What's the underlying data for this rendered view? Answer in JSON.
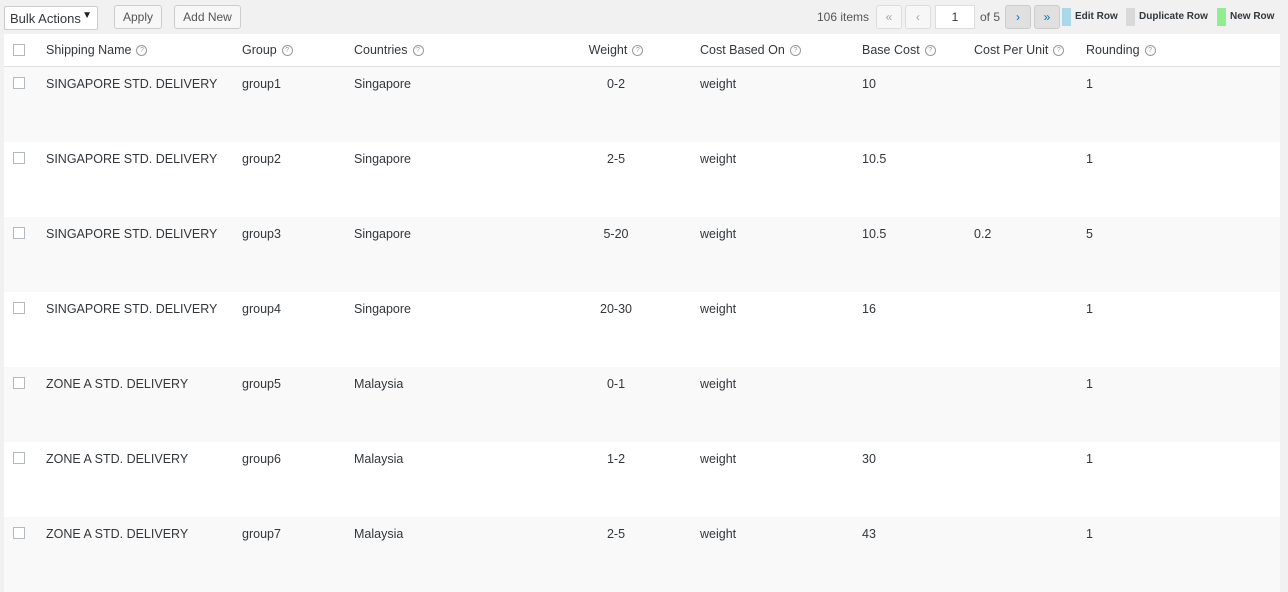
{
  "toolbar": {
    "bulk_actions_label": "Bulk Actions",
    "apply_label": "Apply",
    "add_new_label": "Add New"
  },
  "pagination": {
    "items_count": "106 items",
    "first": "«",
    "prev": "‹",
    "current_page": "1",
    "of_label": "of 5",
    "next": "›",
    "last": "»"
  },
  "legend": {
    "edit_row": "Edit Row",
    "duplicate_row": "Duplicate Row",
    "new_row": "New Row",
    "colors": {
      "edit_row": "#a8d8ea",
      "duplicate_row": "#d9d9d9",
      "new_row": "#90ee90"
    }
  },
  "table": {
    "columns": {
      "shipping_name": "Shipping Name",
      "group": "Group",
      "countries": "Countries",
      "weight": "Weight",
      "cost_based_on": "Cost Based On",
      "base_cost": "Base Cost",
      "cost_per_unit": "Cost Per Unit",
      "rounding": "Rounding"
    },
    "help_icon": "?",
    "rows": [
      {
        "shipping_name": "SINGAPORE STD. DELIVERY",
        "group": "group1",
        "countries": "Singapore",
        "weight": "0-2",
        "cost_based_on": "weight",
        "base_cost": "10",
        "cost_per_unit": "",
        "rounding": "1"
      },
      {
        "shipping_name": "SINGAPORE STD. DELIVERY",
        "group": "group2",
        "countries": "Singapore",
        "weight": "2-5",
        "cost_based_on": "weight",
        "base_cost": "10.5",
        "cost_per_unit": "",
        "rounding": "1"
      },
      {
        "shipping_name": "SINGAPORE STD. DELIVERY",
        "group": "group3",
        "countries": "Singapore",
        "weight": "5-20",
        "cost_based_on": "weight",
        "base_cost": "10.5",
        "cost_per_unit": "0.2",
        "rounding": "5"
      },
      {
        "shipping_name": "SINGAPORE STD. DELIVERY",
        "group": "group4",
        "countries": "Singapore",
        "weight": "20-30",
        "cost_based_on": "weight",
        "base_cost": "16",
        "cost_per_unit": "",
        "rounding": "1"
      },
      {
        "shipping_name": "ZONE A STD. DELIVERY",
        "group": "group5",
        "countries": "Malaysia",
        "weight": "0-1",
        "cost_based_on": "weight",
        "base_cost": "",
        "cost_per_unit": "",
        "rounding": "1"
      },
      {
        "shipping_name": "ZONE A STD. DELIVERY",
        "group": "group6",
        "countries": "Malaysia",
        "weight": "1-2",
        "cost_based_on": "weight",
        "base_cost": "30",
        "cost_per_unit": "",
        "rounding": "1"
      },
      {
        "shipping_name": "ZONE A STD. DELIVERY",
        "group": "group7",
        "countries": "Malaysia",
        "weight": "2-5",
        "cost_based_on": "weight",
        "base_cost": "43",
        "cost_per_unit": "",
        "rounding": "1"
      }
    ]
  }
}
